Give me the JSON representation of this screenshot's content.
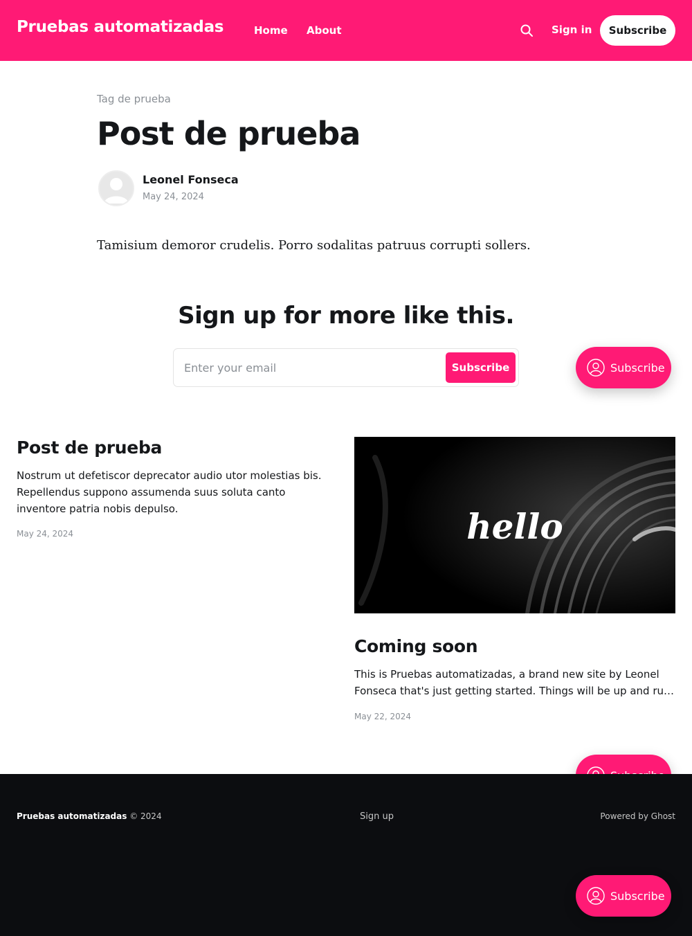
{
  "header": {
    "site_title": "Pruebas automatizadas",
    "nav": [
      {
        "label": "Home"
      },
      {
        "label": "About"
      }
    ],
    "sign_in_label": "Sign in",
    "subscribe_label": "Subscribe",
    "accent_color": "#ff1a75"
  },
  "article": {
    "tag": "Tag de prueba",
    "title": "Post de prueba",
    "author_name": "Leonel Fonseca",
    "date": "May 24, 2024",
    "body": "Tamisium demoror crudelis. Porro sodalitas patruus corrupti sollers."
  },
  "cta": {
    "title": "Sign up for more like this.",
    "email_placeholder": "Enter your email",
    "button_label": "Subscribe"
  },
  "floating_subscribe": {
    "label": "Subscribe"
  },
  "feed": [
    {
      "title": "Post de prueba",
      "excerpt": "Nostrum ut defetiscor deprecator audio utor molestias bis. Repellendus suppono assumenda suus soluta canto inventore patria nobis depulso.",
      "date": "May 24, 2024"
    },
    {
      "image_text": "hello",
      "title": "Coming soon",
      "excerpt_line1": "This is Pruebas automatizadas, a brand new site by Leonel",
      "excerpt_line2": "Fonseca that's just getting started. Things will be up and running here shortly.",
      "date": "May 22, 2024"
    }
  ],
  "footer": {
    "brand": "Pruebas automatizadas",
    "copyright": "© 2024",
    "signup_label": "Sign up",
    "powered_by": "Powered by Ghost",
    "background": "#0c0d10"
  }
}
